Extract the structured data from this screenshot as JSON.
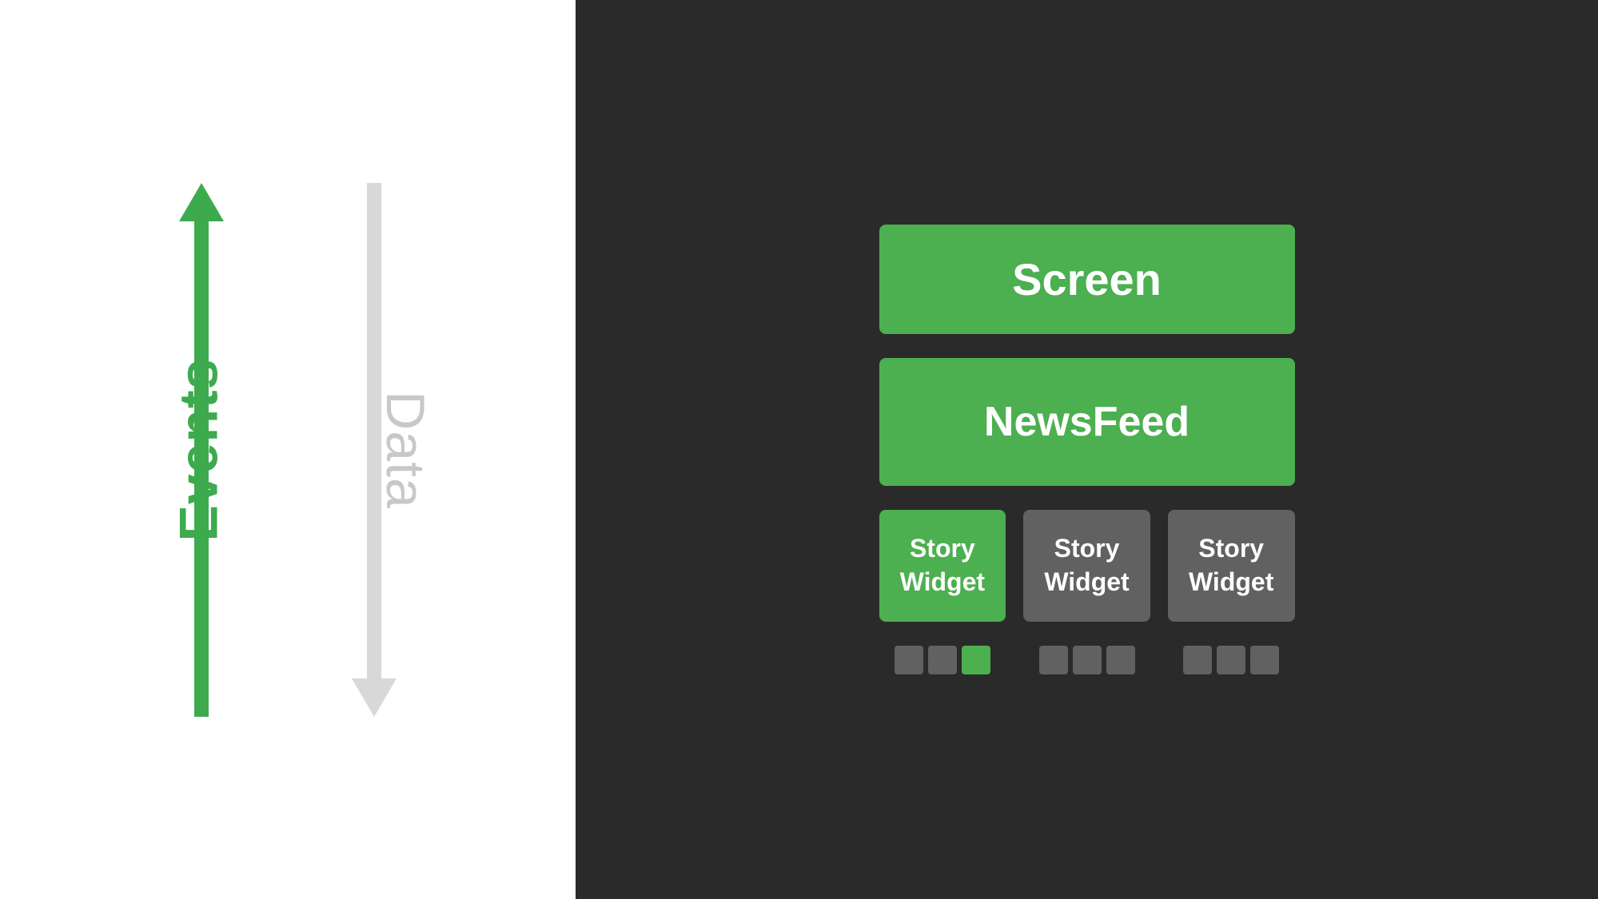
{
  "left": {
    "events_label": "Events",
    "data_label": "Data"
  },
  "right": {
    "screen_label": "Screen",
    "newsfeed_label": "NewsFeed",
    "story_widget_label": "Story\nWidget",
    "story_widgets": [
      {
        "id": 1,
        "type": "green",
        "label": "Story Widget"
      },
      {
        "id": 2,
        "type": "gray",
        "label": "Story Widget"
      },
      {
        "id": 3,
        "type": "gray",
        "label": "Story Widget"
      }
    ],
    "indicator_groups": [
      {
        "dots": [
          "gray",
          "gray",
          "green"
        ]
      },
      {
        "dots": [
          "gray",
          "gray",
          "gray"
        ]
      },
      {
        "dots": [
          "gray",
          "gray",
          "gray"
        ]
      }
    ]
  }
}
